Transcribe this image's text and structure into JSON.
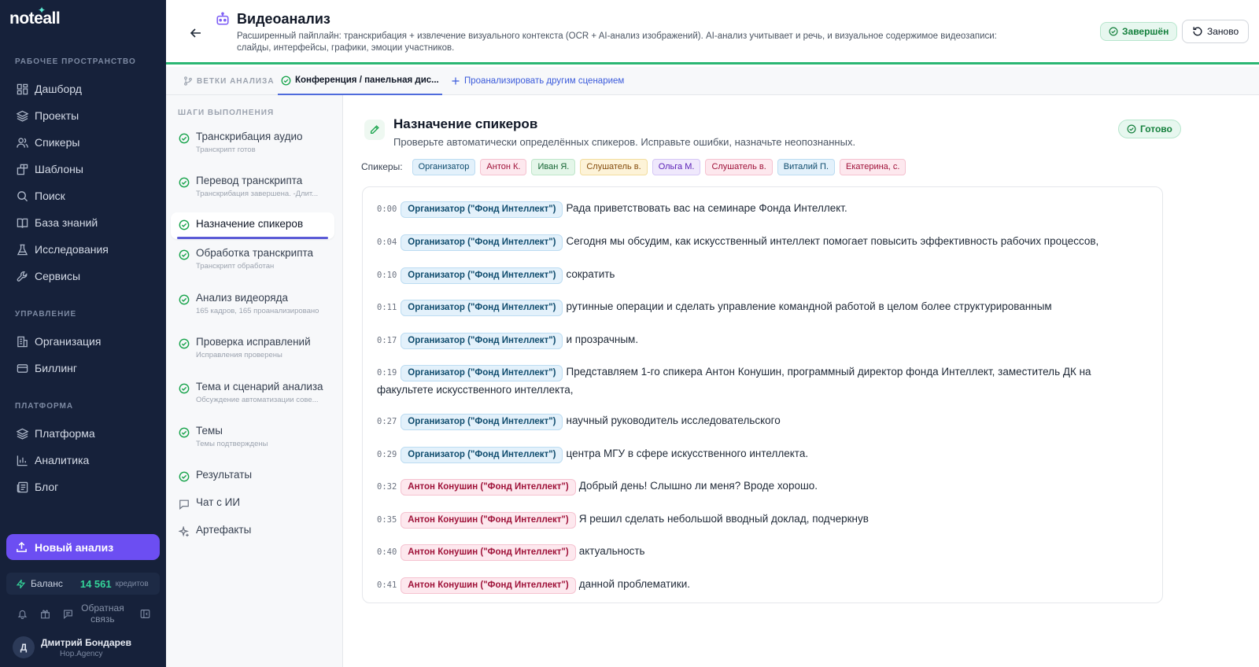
{
  "app": {
    "logo": "noteall",
    "logo_star": "✦"
  },
  "sidebar": {
    "workspace_label": "РАБОЧЕЕ ПРОСТРАНСТВО",
    "workspace_items": [
      {
        "label": "Дашборд",
        "icon": "dashboard-icon"
      },
      {
        "label": "Проекты",
        "icon": "layers-icon"
      },
      {
        "label": "Спикеры",
        "icon": "users-icon"
      },
      {
        "label": "Шаблоны",
        "icon": "templates-icon"
      },
      {
        "label": "Поиск",
        "icon": "search-icon"
      },
      {
        "label": "База знаний",
        "icon": "book-icon"
      },
      {
        "label": "Исследования",
        "icon": "flask-icon"
      },
      {
        "label": "Сервисы",
        "icon": "wrench-icon"
      }
    ],
    "management_label": "УПРАВЛЕНИЕ",
    "management_items": [
      {
        "label": "Организация",
        "icon": "building-icon"
      },
      {
        "label": "Биллинг",
        "icon": "card-icon"
      }
    ],
    "platform_label": "ПЛАТФОРМА",
    "platform_items": [
      {
        "label": "Платформа",
        "icon": "layers-icon"
      },
      {
        "label": "Аналитика",
        "icon": "chart-icon"
      },
      {
        "label": "Блог",
        "icon": "newspaper-icon"
      }
    ],
    "new_analysis": "Новый анализ",
    "balance_label": "Баланс",
    "balance_amount": "14 561",
    "balance_unit": "кредитов",
    "feedback": "Обратная связь",
    "user_initial": "Д",
    "user_name": "Дмитрий Бондарев",
    "user_org": "Hop.Agency"
  },
  "header": {
    "title": "Видеоанализ",
    "subtitle": "Расширенный пайплайн: транскрибация + извлечение визуального контекста (OCR + AI-анализ изображений). AI-анализ учитывает и речь, и визуальное содержимое видеозаписи: слайды, интерфейсы, графики, эмоции участников.",
    "status": "Завершён",
    "restart": "Заново",
    "accent_color": "#2bb673"
  },
  "tabs": {
    "branches": "ВЕТКИ АНАЛИЗА",
    "active": "Конференция / панельная дис...",
    "add": "Проанализировать другим сценарием"
  },
  "steps": {
    "label": "ШАГИ ВЫПОЛНЕНИЯ",
    "items": [
      {
        "title": "Транскрибация аудио",
        "sub": "Транскрипт готов"
      },
      {
        "title": "Перевод транскрипта",
        "sub": "Транскрибация завершена. -Длит..."
      },
      {
        "title": "Назначение спикеров",
        "sub": ""
      },
      {
        "title": "Обработка транскрипта",
        "sub": "Транскрипт обработан"
      },
      {
        "title": "Анализ видеоряда",
        "sub": "165 кадров, 165 проанализировано"
      },
      {
        "title": "Проверка исправлений",
        "sub": "Исправления проверены"
      },
      {
        "title": "Тема и сценарий анализа",
        "sub": "Обсуждение автоматизации сове..."
      },
      {
        "title": "Темы",
        "sub": "Темы подтверждены"
      },
      {
        "title": "Результаты",
        "sub": ""
      },
      {
        "title": "Чат с ИИ",
        "sub": ""
      },
      {
        "title": "Артефакты",
        "sub": ""
      }
    ]
  },
  "main": {
    "title": "Назначение спикеров",
    "description": "Проверьте автоматически определённых спикеров. Исправьте ошибки, назначьте неопознанных.",
    "status": "Готово",
    "speakers_label": "Спикеры:",
    "speakers": [
      {
        "name": "Организатор",
        "bg": "#e3f1fb",
        "border": "#bcdcf2",
        "color": "#0f4c6e"
      },
      {
        "name": "Антон К.",
        "bg": "#fde8ee",
        "border": "#f5c2d0",
        "color": "#9f1239"
      },
      {
        "name": "Иван Я.",
        "bg": "#e4f6e9",
        "border": "#bfe6ca",
        "color": "#166534"
      },
      {
        "name": "Слушатель в.",
        "bg": "#fdf3d8",
        "border": "#f2dd9e",
        "color": "#854d0e"
      },
      {
        "name": "Ольга М.",
        "bg": "#efe8fc",
        "border": "#d6c7f6",
        "color": "#5b21b6"
      },
      {
        "name": "Слушатель в.",
        "bg": "#fde8ee",
        "border": "#f5c2d0",
        "color": "#9f1239"
      },
      {
        "name": "Виталий П.",
        "bg": "#e3f1fb",
        "border": "#bcdcf2",
        "color": "#0f4c6e"
      },
      {
        "name": "Екатерина, с.",
        "bg": "#fde8ee",
        "border": "#f5c2d0",
        "color": "#9f1239"
      }
    ],
    "transcript": [
      {
        "ts": "0:00",
        "speaker": "Организатор (\"Фонд Интеллект\")",
        "kind": "org",
        "text": "Рада приветствовать вас на семинаре Фонда Интеллект."
      },
      {
        "ts": "0:04",
        "speaker": "Организатор (\"Фонд Интеллект\")",
        "kind": "org",
        "text": "Сегодня мы обсудим, как искусственный интеллект помогает повысить эффективность рабочих процессов,"
      },
      {
        "ts": "0:10",
        "speaker": "Организатор (\"Фонд Интеллект\")",
        "kind": "org",
        "text": "сократить"
      },
      {
        "ts": "0:11",
        "speaker": "Организатор (\"Фонд Интеллект\")",
        "kind": "org",
        "text": "рутинные операции и сделать управление командной работой в целом более структурированным"
      },
      {
        "ts": "0:17",
        "speaker": "Организатор (\"Фонд Интеллект\")",
        "kind": "org",
        "text": "и прозрачным."
      },
      {
        "ts": "0:19",
        "speaker": "Организатор (\"Фонд Интеллект\")",
        "kind": "org",
        "text": "Представляем 1-го спикера Антон Конушин, программный директор фонда Интеллект, заместитель ДК на факультете искусственного интеллекта,"
      },
      {
        "ts": "0:27",
        "speaker": "Организатор (\"Фонд Интеллект\")",
        "kind": "org",
        "text": "научный руководитель исследовательского"
      },
      {
        "ts": "0:29",
        "speaker": "Организатор (\"Фонд Интеллект\")",
        "kind": "org",
        "text": "центра МГУ в сфере искусственного интеллекта."
      },
      {
        "ts": "0:32",
        "speaker": "Антон Конушин (\"Фонд Интеллект\")",
        "kind": "anton",
        "text": "Добрый день! Слышно ли меня? Вроде хорошо."
      },
      {
        "ts": "0:35",
        "speaker": "Антон Конушин (\"Фонд Интеллект\")",
        "kind": "anton",
        "text": "Я решил сделать небольшой вводный доклад, подчеркнув"
      },
      {
        "ts": "0:40",
        "speaker": "Антон Конушин (\"Фонд Интеллект\")",
        "kind": "anton",
        "text": "актуальность"
      },
      {
        "ts": "0:41",
        "speaker": "Антон Конушин (\"Фонд Интеллект\")",
        "kind": "anton",
        "text": "данной проблематики."
      }
    ]
  }
}
